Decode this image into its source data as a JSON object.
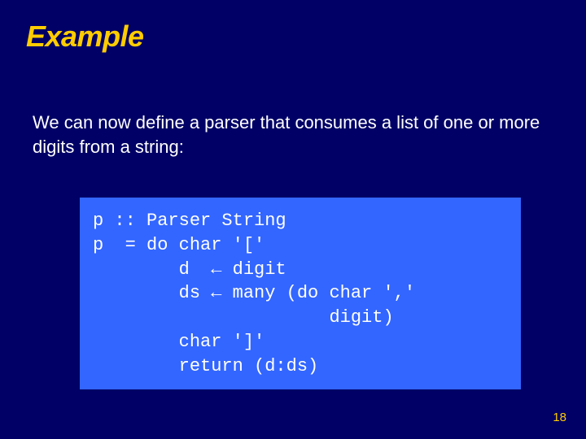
{
  "slide": {
    "title": "Example",
    "body": "We can now define a parser that consumes a list of one or more digits from a string:",
    "code": "p :: Parser String\np  = do char '['\n        d  ← digit\n        ds ← many (do char ','\n                      digit)\n        char ']'\n        return (d:ds)",
    "page_number": "18"
  }
}
